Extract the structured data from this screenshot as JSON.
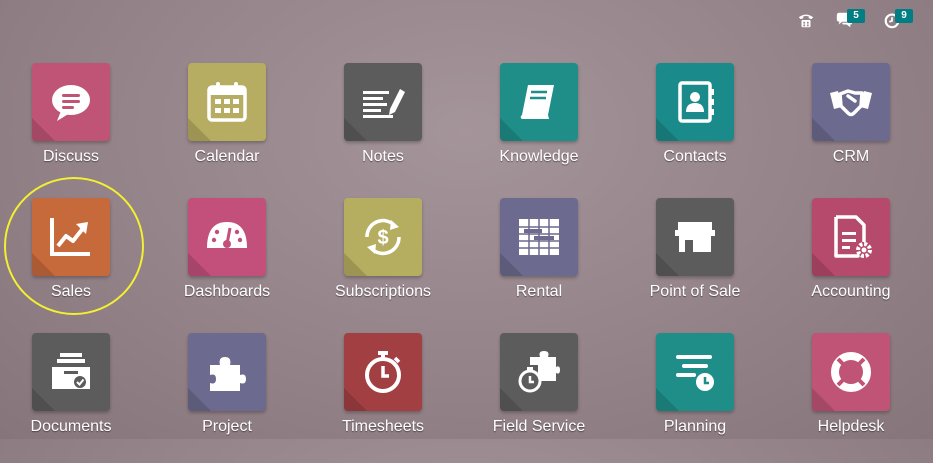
{
  "systray": {
    "phone_icon": "phone-icon",
    "messages_icon": "chat-icon",
    "messages_count": "5",
    "activities_icon": "clock-icon",
    "activities_count": "9"
  },
  "apps": [
    {
      "label": "Discuss",
      "icon": "chat-bubble-icon",
      "color": "#c05476"
    },
    {
      "label": "Calendar",
      "icon": "calendar-icon",
      "color": "#b7ad62"
    },
    {
      "label": "Notes",
      "icon": "notes-icon",
      "color": "#5d5c5c"
    },
    {
      "label": "Knowledge",
      "icon": "book-icon",
      "color": "#1f8e89"
    },
    {
      "label": "Contacts",
      "icon": "address-book-icon",
      "color": "#1b8a8a"
    },
    {
      "label": "CRM",
      "icon": "handshake-icon",
      "color": "#6c6a8e"
    },
    {
      "label": "Sales",
      "icon": "trend-chart-icon",
      "color": "#c66a3c"
    },
    {
      "label": "Dashboards",
      "icon": "gauge-icon",
      "color": "#c2507b"
    },
    {
      "label": "Subscriptions",
      "icon": "recurring-dollar-icon",
      "color": "#b5ad60"
    },
    {
      "label": "Rental",
      "icon": "gantt-icon",
      "color": "#6c6a8e"
    },
    {
      "label": "Point of Sale",
      "icon": "shop-icon",
      "color": "#5d5c5c"
    },
    {
      "label": "Accounting",
      "icon": "invoice-gear-icon",
      "color": "#b64a6c"
    },
    {
      "label": "Documents",
      "icon": "inbox-tray-icon",
      "color": "#5d5c5c"
    },
    {
      "label": "Project",
      "icon": "puzzle-icon",
      "color": "#6c6a8e"
    },
    {
      "label": "Timesheets",
      "icon": "stopwatch-icon",
      "color": "#a23f43"
    },
    {
      "label": "Field Service",
      "icon": "puzzle-stopwatch-icon",
      "color": "#5d5c5c"
    },
    {
      "label": "Planning",
      "icon": "planning-icon",
      "color": "#1f8e89"
    },
    {
      "label": "Helpdesk",
      "icon": "lifebuoy-icon",
      "color": "#c05476"
    }
  ]
}
